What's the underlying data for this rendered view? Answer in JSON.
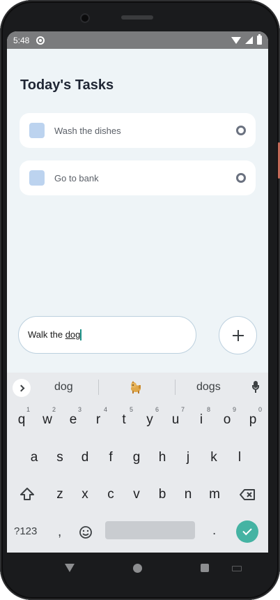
{
  "status_bar": {
    "time": "5:48",
    "icons": [
      "at-icon",
      "wifi-icon",
      "signal-icon",
      "battery-icon"
    ]
  },
  "app": {
    "title": "Today's Tasks",
    "tasks": [
      {
        "label": "Wash the dishes"
      },
      {
        "label": "Go to bank"
      }
    ],
    "input": {
      "value_prefix": "Walk the ",
      "value_composing": "dog"
    },
    "add_button_icon": "plus-icon"
  },
  "keyboard": {
    "suggestions": [
      "dog",
      "dog-emoji",
      "dogs"
    ],
    "row1": [
      "q",
      "w",
      "e",
      "r",
      "t",
      "y",
      "u",
      "i",
      "o",
      "p"
    ],
    "row1_hints": [
      "1",
      "2",
      "3",
      "4",
      "5",
      "6",
      "7",
      "8",
      "9",
      "0"
    ],
    "row2": [
      "a",
      "s",
      "d",
      "f",
      "g",
      "h",
      "j",
      "k",
      "l"
    ],
    "row3": [
      "z",
      "x",
      "c",
      "v",
      "b",
      "n",
      "m"
    ],
    "symbols_label": "?123",
    "comma": ",",
    "period": "."
  },
  "colors": {
    "background": "#eef4f7",
    "checkbox": "#bcd3ef",
    "enter_key": "#45b3a3",
    "caret": "#1a8f85"
  }
}
